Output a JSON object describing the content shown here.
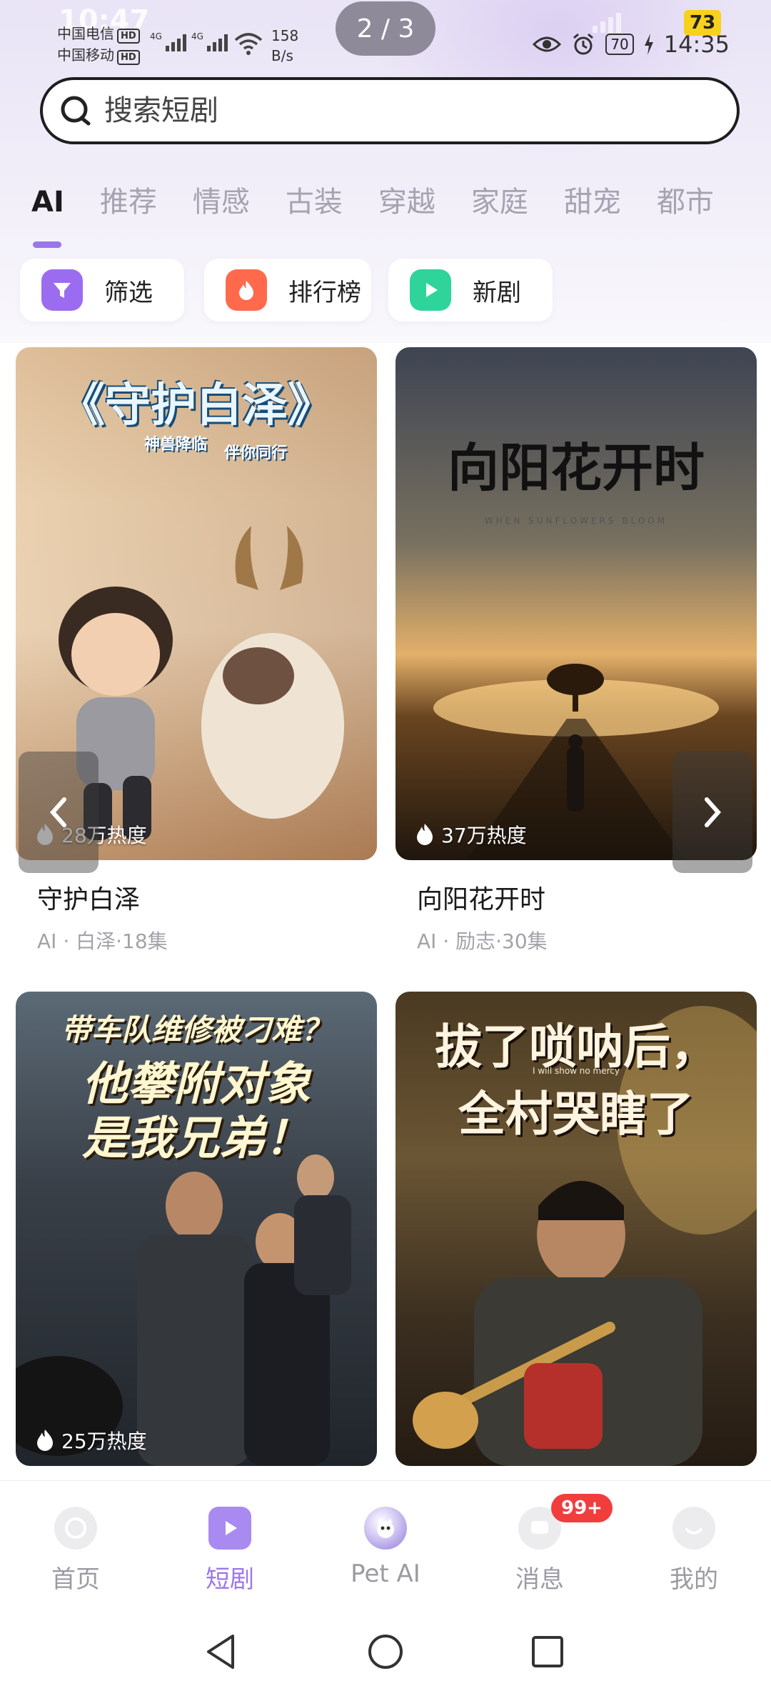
{
  "status_bar": {
    "carrier1": "中国电信",
    "carrier2": "中国移动",
    "hd": "HD",
    "net_type": "4G",
    "net_speed_value": "158",
    "net_speed_unit": "B/s",
    "battery": "70",
    "time": "14:35",
    "corner_badge": "73",
    "ghost_clock": "10:47"
  },
  "page_indicator": "2 / 3",
  "search": {
    "placeholder": "搜索短剧"
  },
  "tabs": [
    "AI",
    "推荐",
    "情感",
    "古装",
    "穿越",
    "家庭",
    "甜宠",
    "都市"
  ],
  "active_tab": "AI",
  "chips": [
    {
      "label": "筛选",
      "icon": "filter-icon",
      "color": "#9b6cf0"
    },
    {
      "label": "排行榜",
      "icon": "flame-icon",
      "color": "#ff6a4d"
    },
    {
      "label": "新剧",
      "icon": "play-icon",
      "color": "#2fd49a"
    }
  ],
  "cards": [
    {
      "title": "守护白泽",
      "poster_title": "《守护白泽》",
      "poster_subtitle_1": "神兽降临",
      "poster_subtitle_2": "伴你同行",
      "heat": "28万热度",
      "meta": "AI · 白泽·18集"
    },
    {
      "title": "向阳花开时",
      "poster_title": "向阳花开时",
      "poster_subtitle": "WHEN SUNFLOWERS BLOOM",
      "heat": "37万热度",
      "meta": "AI · 励志·30集"
    },
    {
      "title": "带车队维修被刁难？他攀附对象是我兄弟！",
      "poster_line_1": "带车队维修被刁难？",
      "poster_line_2": "他攀附对象",
      "poster_line_3": "是我兄弟！",
      "heat": "25万热度"
    },
    {
      "title": "拔了唢呐后，全村哭瞎了",
      "poster_line_1": "拔了唢呐后，",
      "poster_line_2": "全村哭瞎了",
      "poster_small": "I will show no mercy"
    }
  ],
  "bottom_nav": [
    {
      "label": "首页",
      "icon": "home-icon"
    },
    {
      "label": "短剧",
      "icon": "short-drama-icon"
    },
    {
      "label": "Pet AI",
      "icon": "pet-ai-icon"
    },
    {
      "label": "消息",
      "icon": "message-icon",
      "badge": "99+"
    },
    {
      "label": "我的",
      "icon": "profile-icon"
    }
  ],
  "active_nav": "短剧",
  "colors": {
    "accent": "#9a75ec",
    "active_nav_label": "#9d77e8",
    "inactive_tab": "#a6a3b0",
    "badge_red": "#f23d3d",
    "page_pill": "#8e8a99"
  }
}
